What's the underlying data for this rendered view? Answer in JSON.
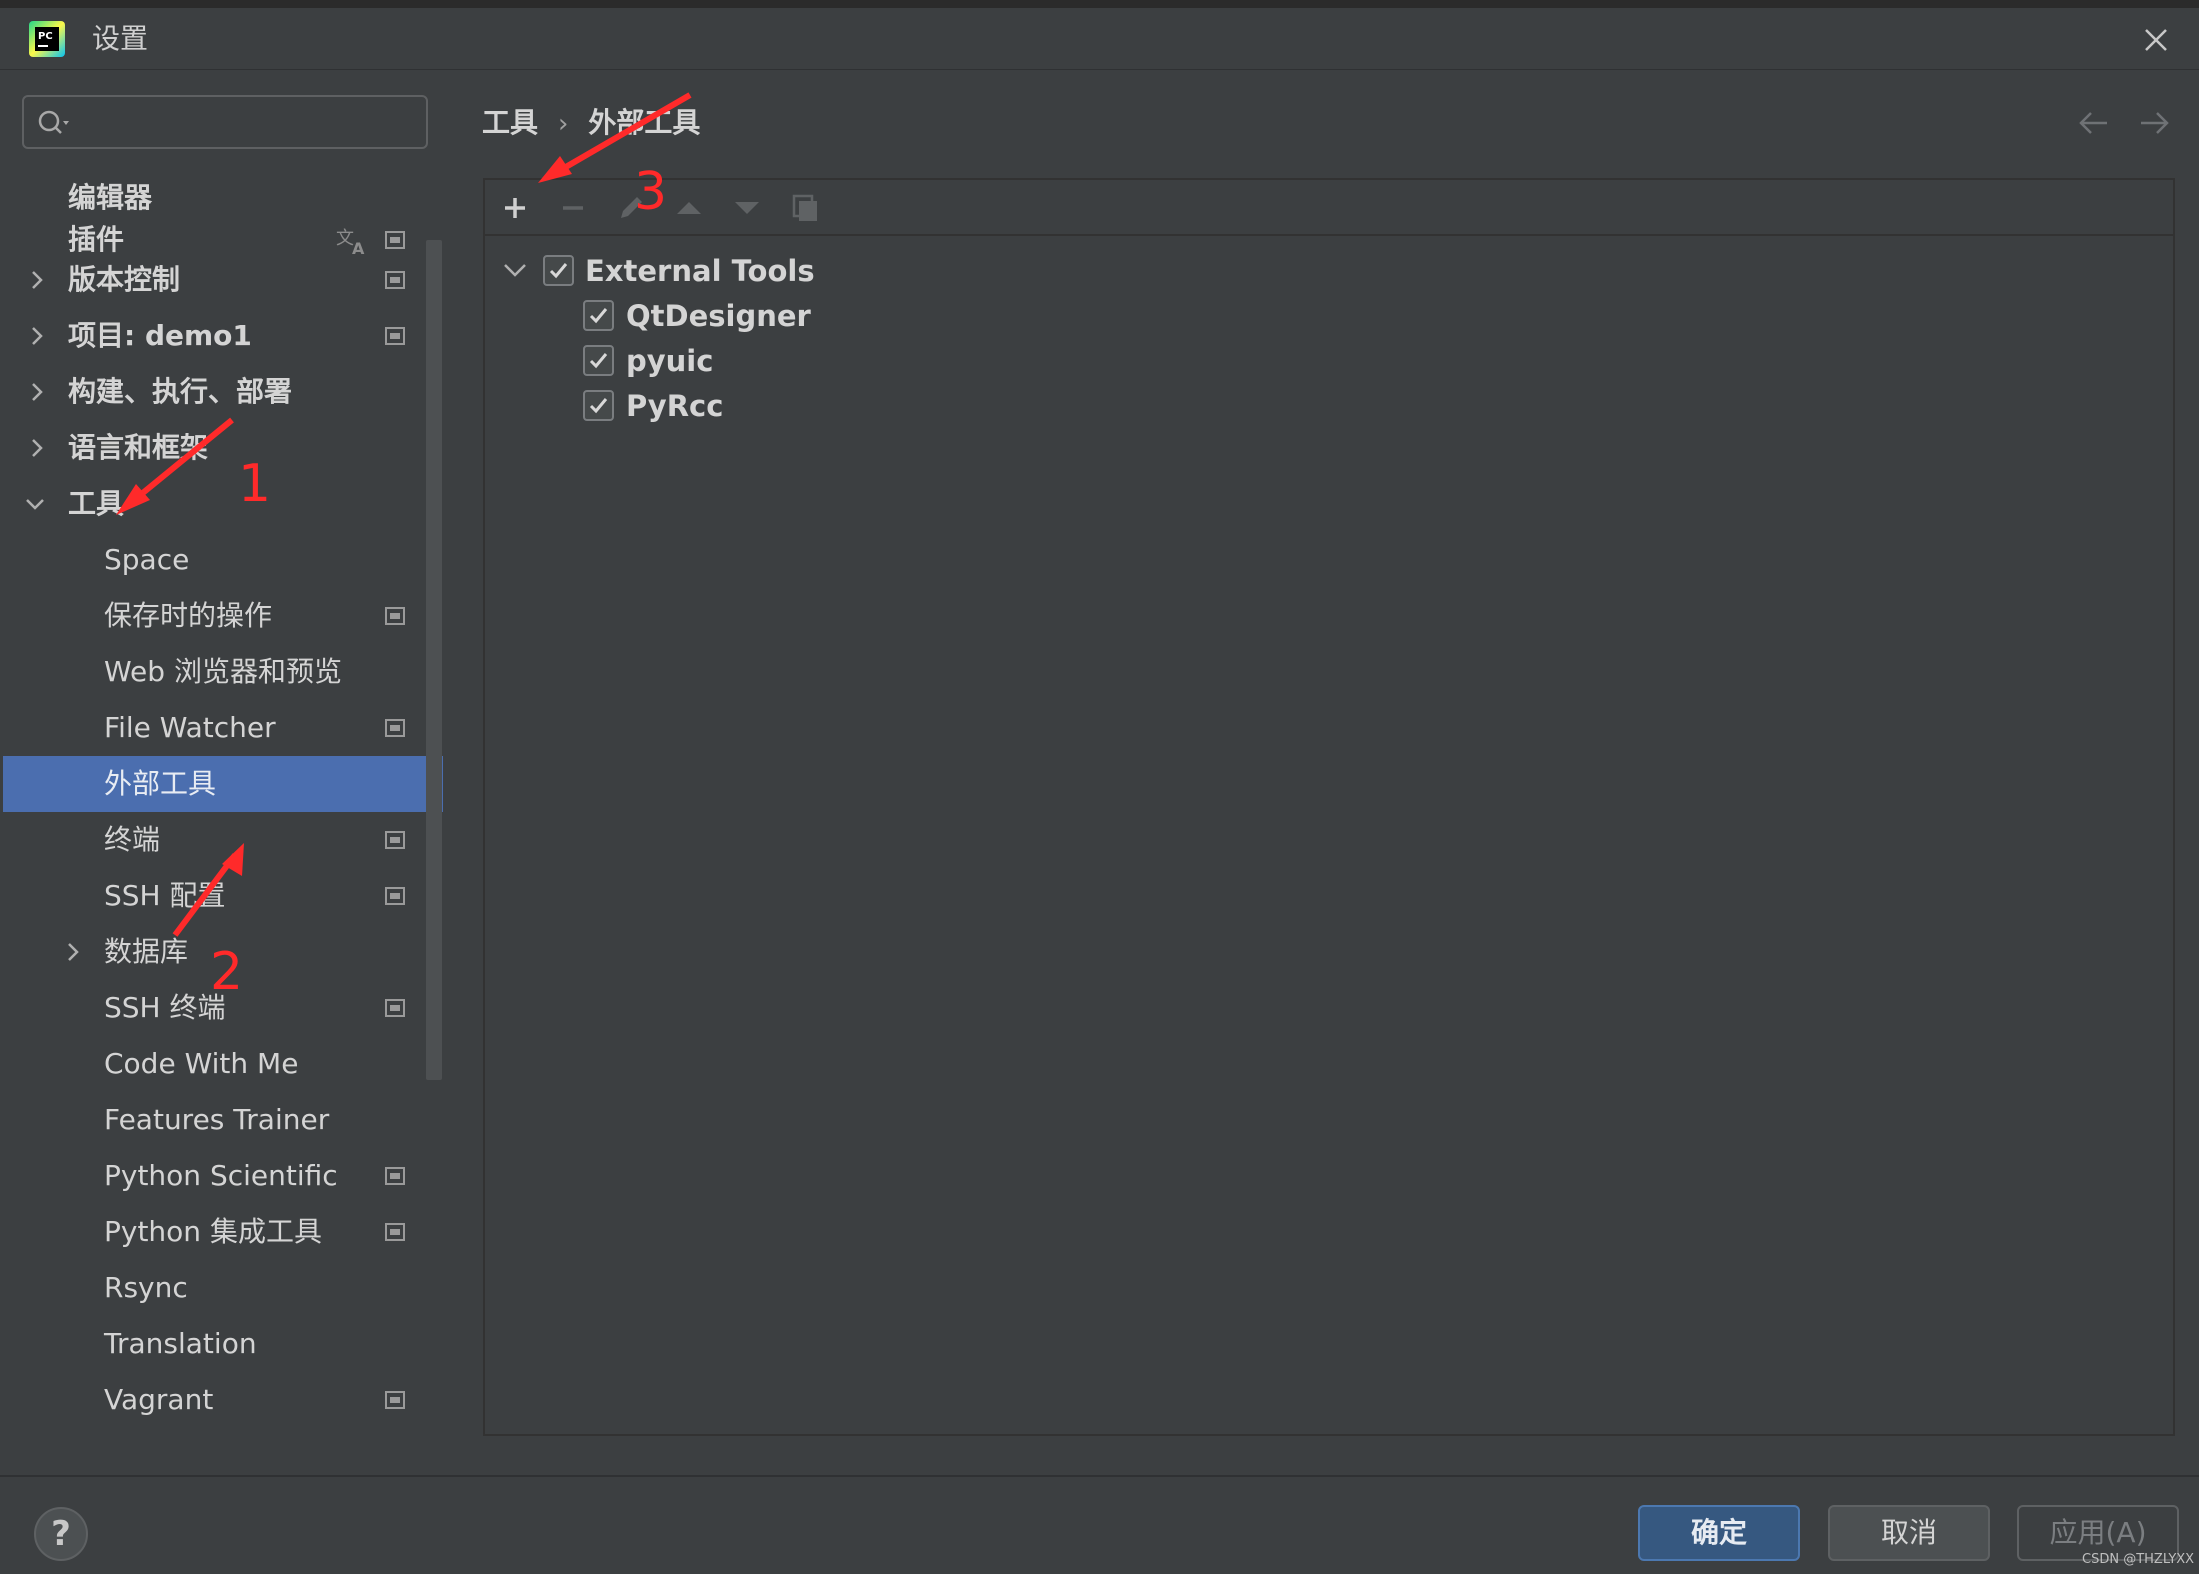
{
  "window": {
    "title": "设置",
    "icon": "pycharm-logo",
    "logo_text": "PC"
  },
  "sidebar": {
    "search": {
      "value": "",
      "placeholder": ""
    },
    "items": [
      {
        "label": "编辑器",
        "bold": true,
        "expandable": false
      },
      {
        "label": "插件",
        "bold": true,
        "expandable": false,
        "translate_icon": true
      },
      {
        "label": "版本控制",
        "bold": true,
        "expandable": true,
        "expanded": false
      },
      {
        "label": "项目: demo1",
        "bold": true,
        "expandable": true,
        "expanded": false
      },
      {
        "label": "构建、执行、部署",
        "bold": true,
        "expandable": true,
        "expanded": false
      },
      {
        "label": "语言和框架",
        "bold": true,
        "expandable": true,
        "expanded": false
      },
      {
        "label": "工具",
        "bold": true,
        "expandable": true,
        "expanded": true
      },
      {
        "label": "Space"
      },
      {
        "label": "保存时的操作"
      },
      {
        "label": "Web 浏览器和预览"
      },
      {
        "label": "File Watcher"
      },
      {
        "label": "外部工具",
        "selected": true
      },
      {
        "label": "终端"
      },
      {
        "label": "SSH 配置"
      },
      {
        "label": "数据库",
        "expandable": true,
        "expanded": false
      },
      {
        "label": "SSH 终端"
      },
      {
        "label": "Code With Me"
      },
      {
        "label": "Features Trainer"
      },
      {
        "label": "Python Scientific"
      },
      {
        "label": "Python 集成工具"
      },
      {
        "label": "Rsync"
      },
      {
        "label": "Translation"
      },
      {
        "label": "Vagrant"
      }
    ]
  },
  "main": {
    "breadcrumb": {
      "parent": "工具",
      "separator": "›",
      "current": "外部工具"
    },
    "toolbar": [
      "add-icon",
      "remove-icon",
      "edit-icon",
      "move-up-icon",
      "move-down-icon",
      "copy-icon"
    ],
    "tools_tree": {
      "group": {
        "label": "External Tools",
        "checked": true,
        "expanded": true
      },
      "children": [
        {
          "label": "QtDesigner",
          "checked": true
        },
        {
          "label": "pyuic",
          "checked": true
        },
        {
          "label": "PyRcc",
          "checked": true
        }
      ]
    }
  },
  "footer": {
    "help_label": "?",
    "ok_label": "确定",
    "cancel_label": "取消",
    "apply_label": "应用(A)",
    "watermark": "CSDN @THZLYXX"
  },
  "annotations": {
    "step1": "1",
    "step2": "2",
    "step3": "3"
  },
  "colors": {
    "background": "#3c3f41",
    "selection": "#4b6eaf",
    "primary_button": "#365880",
    "annotation_red": "#ff2a2a"
  }
}
